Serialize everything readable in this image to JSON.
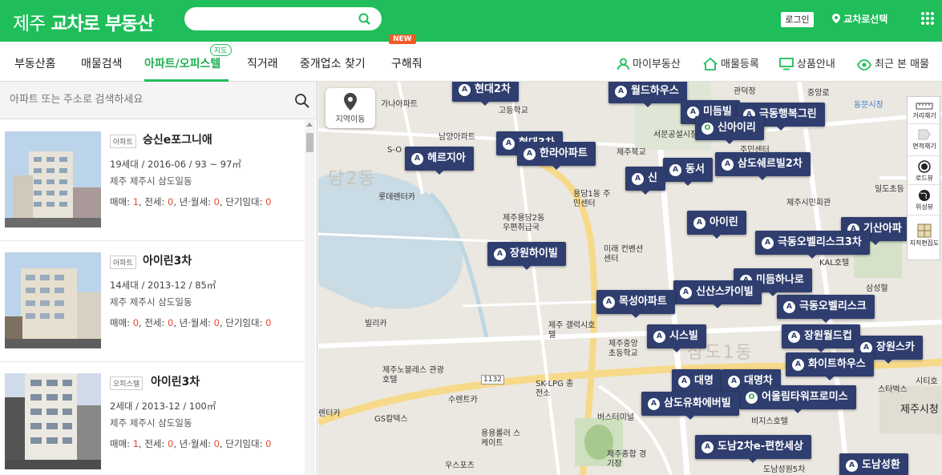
{
  "header": {
    "logo_prefix": "제주",
    "logo_main": "교차로 부동산",
    "search_placeholder": "",
    "login_label": "로그인",
    "region_label": "교차로선택"
  },
  "nav": {
    "items": [
      "부동산홈",
      "매물검색",
      "아파트/오피스텔",
      "직거래",
      "중개업소 찾기",
      "구해줘"
    ],
    "badge_map": "지도",
    "badge_new": "NEW",
    "utils": [
      "마이부동산",
      "매물등록",
      "상품안내",
      "최근 본 매물"
    ]
  },
  "list": {
    "search_placeholder": "아파트 또는 주소로 검색하세요",
    "items": [
      {
        "type": "아파트",
        "name": "승신e포그니애",
        "info": "19세대 / 2016-06 / 93 ~ 97㎡",
        "addr": "제주 제주시 삼도일동",
        "sale": "1",
        "jeonse": "0",
        "monthly": "0",
        "short": "0"
      },
      {
        "type": "아파트",
        "name": "아이린3차",
        "info": "14세대 / 2013-12 / 85㎡",
        "addr": "제주 제주시 삼도일동",
        "sale": "0",
        "jeonse": "0",
        "monthly": "0",
        "short": "0"
      },
      {
        "type": "오피스텔",
        "name": "아이린3차",
        "info": "2세대 / 2013-12 / 100㎡",
        "addr": "제주 제주시 삼도일동",
        "sale": "1",
        "jeonse": "0",
        "monthly": "0",
        "short": "0"
      }
    ],
    "labels": {
      "sale": "매매: ",
      "jeonse": ", 전세: ",
      "monthly": ", 년·월세: ",
      "short": ", 단기임대: "
    }
  },
  "map": {
    "move_label": "지역이동",
    "tools": [
      "거리재기",
      "면적재기",
      "로드뷰",
      "위성뷰",
      "지적편집도"
    ],
    "district_labels": [
      "담2동",
      "삼도1동"
    ],
    "pois": [
      "관덕정",
      "중앙로",
      "동문시장",
      "가나아파트",
      "고등학교",
      "남양아파트",
      "S-O",
      "서문공설시장",
      "주민센터",
      "제주북교",
      "용담1동 주민센터",
      "제주시민회관",
      "롯데렌터카",
      "일도초등",
      "제주용담2동 우편취급국",
      "미래 컨벤션센터",
      "KAL호텔",
      "삼성혈",
      "빌리카",
      "제주 갤럭시호텔",
      "제주중앙 초등학교",
      "제주노블레스 관광호텔",
      "수렌트카",
      "SK-LPG 충전소",
      "1132",
      "렌터카",
      "GS칼텍스",
      "버스터미널",
      "비지스호텔",
      "스타벅스",
      "시티호",
      "제주시청",
      "용용롤러 스케이트",
      "우스포츠",
      "제주종합 경기장",
      "도남성원5차"
    ],
    "pins": [
      {
        "icon": "A",
        "label": "현대2차"
      },
      {
        "icon": "A",
        "label": "월드하우스"
      },
      {
        "icon": "A",
        "label": "미듬빌"
      },
      {
        "icon": "A",
        "label": "극동행복그린"
      },
      {
        "icon": "O",
        "label": "신아이리"
      },
      {
        "icon": "A",
        "label": "현대3차"
      },
      {
        "icon": "A",
        "label": "한라아파트"
      },
      {
        "icon": "A",
        "label": "헤르지아"
      },
      {
        "icon": "A",
        "label": "삼도쉐르빌2차"
      },
      {
        "icon": "A",
        "label": "동서"
      },
      {
        "icon": "A",
        "label": "신"
      },
      {
        "icon": "A",
        "label": "아이린"
      },
      {
        "icon": "A",
        "label": "기산아파"
      },
      {
        "icon": "A",
        "label": "극동오벨리스크3차"
      },
      {
        "icon": "A",
        "label": "장원하이빌"
      },
      {
        "icon": "A",
        "label": "미듬하나로"
      },
      {
        "icon": "A",
        "label": "신산스카이빌"
      },
      {
        "icon": "A",
        "label": "목성아파트"
      },
      {
        "icon": "A",
        "label": "극동오벨리스크"
      },
      {
        "icon": "A",
        "label": "시스빌"
      },
      {
        "icon": "A",
        "label": "장원월드컵"
      },
      {
        "icon": "A",
        "label": "장원스카"
      },
      {
        "icon": "A",
        "label": "화이트하우스"
      },
      {
        "icon": "A",
        "label": "대명"
      },
      {
        "icon": "A",
        "label": "대명차"
      },
      {
        "icon": "O",
        "label": "어울림타워프로미스"
      },
      {
        "icon": "A",
        "label": "삼도유화에버빌"
      },
      {
        "icon": "A",
        "label": "도남2차e-편한세상"
      },
      {
        "icon": "A",
        "label": "도남성환"
      }
    ]
  },
  "colors": {
    "brand": "#1fbe5a",
    "pin": "#2f3e6f",
    "accent_red": "#e34b2f"
  }
}
